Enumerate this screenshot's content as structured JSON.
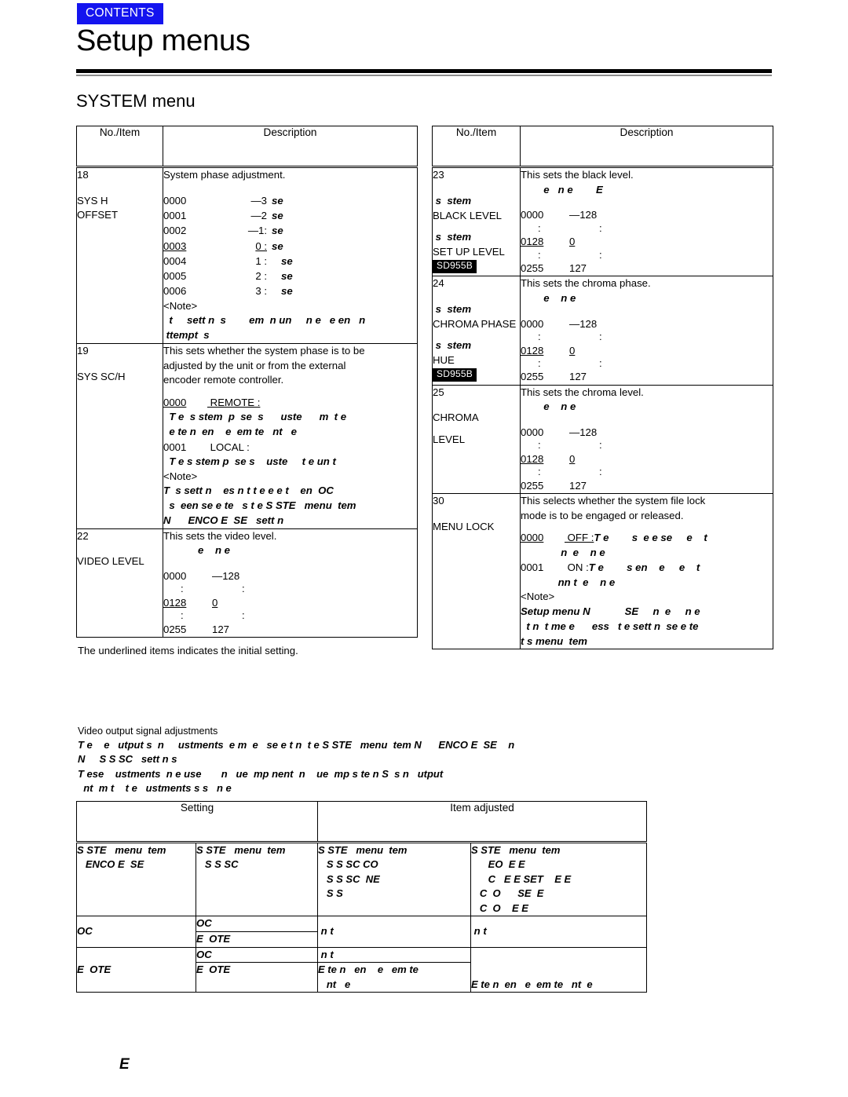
{
  "header": {
    "contents_label": "CONTENTS",
    "contents_bg": "#1414ef",
    "page_title": "Setup menus",
    "section_title": "SYSTEM menu"
  },
  "table_headers": {
    "no_item": "No./Item",
    "description": "Description"
  },
  "left_table": {
    "rows": [
      {
        "no": "18",
        "item_line1": "SYS H",
        "item_line2": "OFFSET",
        "desc_title": "System phase adjustment.",
        "values": [
          {
            "code": "0000",
            "val": "—3",
            "unit": "se",
            "underline": false,
            "indent": 0
          },
          {
            "code": "0001",
            "val": "—2",
            "unit": "se",
            "underline": false,
            "indent": 0
          },
          {
            "code": "0002",
            "val": "—1:",
            "unit": "se",
            "underline": false,
            "indent": 0
          },
          {
            "code": "0003",
            "val": "0 :",
            "unit": "se",
            "underline": true,
            "indent": 0
          },
          {
            "code": "0004",
            "val": "1 :",
            "unit": "se",
            "underline": false,
            "indent": 1
          },
          {
            "code": "0005",
            "val": "2 :",
            "unit": "se",
            "underline": false,
            "indent": 1
          },
          {
            "code": "0006",
            "val": "3 :",
            "unit": "se",
            "underline": false,
            "indent": 1
          }
        ],
        "note_label": "<Note>",
        "note_lines": [
          "  t     sett n  s        em  n un     n e   e en   n",
          " ttempt  s"
        ]
      },
      {
        "no": "19",
        "item_line1": "SYS SC/H",
        "item_line2": "",
        "desc_lines": [
          "This sets whether the system phase is to be",
          "adjusted by the unit or from the external",
          "encoder remote controller."
        ],
        "options": [
          {
            "code": "0000",
            "code_underline": true,
            "label": "REMOTE",
            "label_underline": true,
            "deg_lines": [
              "  T e  s stem  p  se  s      uste      m  t e",
              "  e te n  en    e  em te   nt   e"
            ]
          },
          {
            "code": "0001",
            "code_underline": false,
            "label": "LOCAL",
            "label_underline": false,
            "deg_lines": [
              "  T e s stem p  se s    uste     t e un t"
            ]
          }
        ],
        "note_label": "<Note>",
        "note_lines": [
          "T  s sett n    es n t t e e e t    en  OC",
          "  s  een se e te   s t e S STE   menu  tem",
          "N      ENCO E  SE   sett n"
        ]
      },
      {
        "no": "22",
        "item_line1": "VIDEO LEVEL",
        "item_line2": "",
        "desc_title": "This sets the video level.",
        "deg_subtitle": "            e    n e",
        "range": [
          {
            "code": "0000",
            "val": "—128",
            "underline": false
          },
          {
            "code": ":",
            "val": ":",
            "underline": false
          },
          {
            "code": "0128",
            "val": "0",
            "underline": true
          },
          {
            "code": ":",
            "val": ":",
            "underline": false
          },
          {
            "code": "0255",
            "val": "127",
            "underline": false
          }
        ]
      }
    ],
    "footnote": "The underlined items indicates the initial setting."
  },
  "right_table": {
    "rows": [
      {
        "no": "23",
        "item_blocks": [
          {
            "deg": " s  stem",
            "plain": "BLACK LEVEL"
          },
          {
            "deg": " s  stem",
            "plain": "SET UP LEVEL"
          }
        ],
        "badge": "SD955B",
        "desc_title": "This sets the black level.",
        "deg_subtitle": "        e   n e        E",
        "range": [
          {
            "code": "0000",
            "val": "—128",
            "underline": false
          },
          {
            "code": ":",
            "val": ":",
            "underline": false
          },
          {
            "code": "0128",
            "val": "0",
            "underline": true
          },
          {
            "code": ":",
            "val": ":",
            "underline": false
          },
          {
            "code": "0255",
            "val": "127",
            "underline": false
          }
        ]
      },
      {
        "no": "24",
        "item_blocks": [
          {
            "deg": " s  stem",
            "plain": "CHROMA PHASE"
          },
          {
            "deg": " s  stem",
            "plain": "HUE"
          }
        ],
        "badge": "SD955B",
        "desc_title": "This sets the chroma phase.",
        "deg_subtitle": "        e    n e",
        "range": [
          {
            "code": "0000",
            "val": "—128",
            "underline": false
          },
          {
            "code": ":",
            "val": ":",
            "underline": false
          },
          {
            "code": "0128",
            "val": "0",
            "underline": true
          },
          {
            "code": ":",
            "val": ":",
            "underline": false
          },
          {
            "code": "0255",
            "val": "127",
            "underline": false
          }
        ]
      },
      {
        "no": "25",
        "item_blocks": [
          {
            "deg": "",
            "plain": "CHROMA"
          },
          {
            "deg": "",
            "plain": "LEVEL"
          }
        ],
        "badge": "",
        "desc_title": "This sets the chroma level.",
        "deg_subtitle": "        e    n e",
        "range": [
          {
            "code": "0000",
            "val": "—128",
            "underline": false
          },
          {
            "code": ":",
            "val": ":",
            "underline": false
          },
          {
            "code": "0128",
            "val": "0",
            "underline": true
          },
          {
            "code": ":",
            "val": ":",
            "underline": false
          },
          {
            "code": "0255",
            "val": "127",
            "underline": false
          }
        ]
      },
      {
        "no": "30",
        "item_blocks": [
          {
            "deg": "",
            "plain": "MENU LOCK"
          }
        ],
        "badge": "",
        "desc_lines": [
          "This selects whether the system file lock",
          "mode is to be engaged or released."
        ],
        "options": [
          {
            "code": "0000",
            "code_underline": true,
            "label": "OFF",
            "label_underline": true,
            "inline_deg": "T e        s  e e se     e    t",
            "deg_lines": [
              "              n  e    n e"
            ]
          },
          {
            "code": "0001",
            "code_underline": false,
            "label": "ON",
            "label_underline": false,
            "inline_deg": "T e        s en    e     e    t",
            "deg_lines": [
              "             nn t  e    n e"
            ]
          }
        ],
        "note_label": "<Note>",
        "note_lines": [
          "Setup menu N            SE     n  e     n e",
          "  t n  t me e      ess   t e sett n  se e te",
          "t s menu  tem"
        ]
      }
    ]
  },
  "bottom_section": {
    "heading": "Video output signal adjustments",
    "deg_paragraph": [
      "T e    e   utput s  n     ustments  e m  e   se e t n  t e S STE   menu  tem N      ENCO E  SE    n",
      "N     S S SC   sett n s",
      "T ese    ustments  n e use       n   ue  mp nent  n    ue  mp s te n S  s n   utput",
      "  nt  m t    t e   ustments s s   n e"
    ],
    "table": {
      "headers": [
        "Setting",
        "Item adjusted"
      ],
      "subheaders_deg": [
        [
          "S STE   menu  tem",
          "   ENCO E  SE"
        ],
        [
          "S STE   menu  tem",
          "   S S SC"
        ],
        [
          "S STE   menu  tem",
          "   S S SC CO",
          "   S S SC  NE",
          "   S S"
        ],
        [
          "S STE   menu  tem",
          "      EO  E E",
          "      C   E E SET    E E",
          "   C  O      SE  E",
          "   C  O    E E"
        ]
      ],
      "rows": [
        {
          "col1": "OC",
          "col2a": "OC",
          "col2b": "E  OTE",
          "col3": " n t",
          "col4": " n t",
          "col3_merged": true,
          "col4_merged": true
        },
        {
          "col1": "E  OTE",
          "col2a": "OC",
          "col2b": "E  OTE",
          "col3a": " n t",
          "col3b_lines": [
            "E te n   en    e   em te",
            "   nt   e"
          ],
          "col4": "E te n  en   e  em te   nt  e"
        }
      ]
    }
  },
  "footer": {
    "mark": "E"
  }
}
